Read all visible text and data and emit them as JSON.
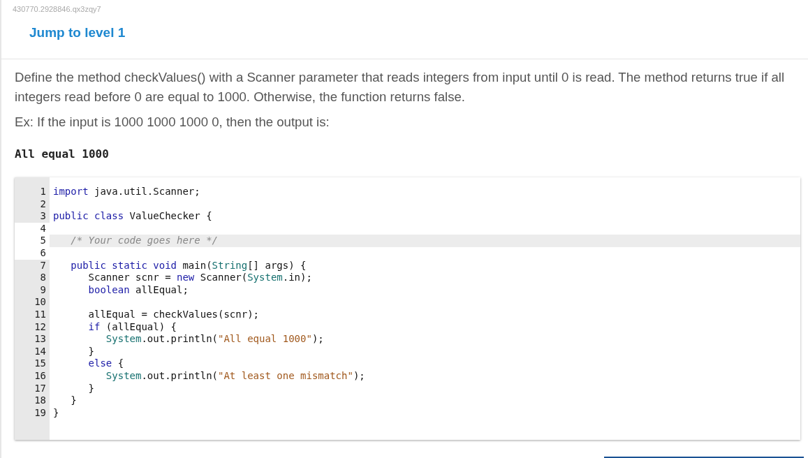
{
  "page_id": "430770.2928846.qx3zqy7",
  "jump_link": "Jump to level 1",
  "instructions": [
    "Define the method checkValues() with a Scanner parameter that reads integers from input until 0 is read. The method returns true if all integers read before 0 are equal to 1000. Otherwise, the function returns false.",
    "Ex: If the input is 1000 1000 1000 0, then the output is:"
  ],
  "example_output": "All equal 1000",
  "editor": {
    "lines": [
      {
        "number": "1",
        "readonly": true,
        "active": false,
        "tokens": [
          {
            "kind": "keyword",
            "text": "import"
          },
          {
            "kind": "plain",
            "text": " java.util.Scanner;"
          }
        ]
      },
      {
        "number": "2",
        "readonly": true,
        "active": false
      },
      {
        "number": "3",
        "readonly": true,
        "active": false,
        "tokens": [
          {
            "kind": "keyword",
            "text": "public class"
          },
          {
            "kind": "plain",
            "text": " ValueChecker {"
          }
        ]
      },
      {
        "number": "4",
        "readonly": false,
        "active": false
      },
      {
        "number": "5",
        "readonly": false,
        "active": true,
        "tokens": [
          {
            "kind": "comment",
            "text": "   /* Your code goes here */"
          }
        ]
      },
      {
        "number": "6",
        "readonly": false,
        "active": false
      },
      {
        "number": "7",
        "readonly": true,
        "active": false,
        "tokens": [
          {
            "kind": "keyword",
            "text": "   public static void"
          },
          {
            "kind": "plain",
            "text": " main("
          },
          {
            "kind": "type",
            "text": "String"
          },
          {
            "kind": "plain",
            "text": "[] args) {"
          }
        ]
      },
      {
        "number": "8",
        "readonly": true,
        "active": false,
        "tokens": [
          {
            "kind": "plain",
            "text": "      Scanner scnr = "
          },
          {
            "kind": "keyword",
            "text": "new"
          },
          {
            "kind": "plain",
            "text": " Scanner("
          },
          {
            "kind": "type",
            "text": "System"
          },
          {
            "kind": "plain",
            "text": ".in);"
          }
        ]
      },
      {
        "number": "9",
        "readonly": true,
        "active": false,
        "tokens": [
          {
            "kind": "keyword",
            "text": "      boolean"
          },
          {
            "kind": "plain",
            "text": " allEqual;"
          }
        ]
      },
      {
        "number": "10",
        "readonly": true,
        "active": false
      },
      {
        "number": "11",
        "readonly": true,
        "active": false,
        "tokens": [
          {
            "kind": "plain",
            "text": "      allEqual = checkValues(scnr);"
          }
        ]
      },
      {
        "number": "12",
        "readonly": true,
        "active": false,
        "tokens": [
          {
            "kind": "keyword",
            "text": "      if"
          },
          {
            "kind": "plain",
            "text": " (allEqual) {"
          }
        ]
      },
      {
        "number": "13",
        "readonly": true,
        "active": false,
        "tokens": [
          {
            "kind": "type",
            "text": "         System"
          },
          {
            "kind": "plain",
            "text": ".out.println("
          },
          {
            "kind": "string",
            "text": "\"All equal 1000\""
          },
          {
            "kind": "plain",
            "text": ");"
          }
        ]
      },
      {
        "number": "14",
        "readonly": true,
        "active": false,
        "tokens": [
          {
            "kind": "plain",
            "text": "      }"
          }
        ]
      },
      {
        "number": "15",
        "readonly": true,
        "active": false,
        "tokens": [
          {
            "kind": "keyword",
            "text": "      else"
          },
          {
            "kind": "plain",
            "text": " {"
          }
        ]
      },
      {
        "number": "16",
        "readonly": true,
        "active": false,
        "tokens": [
          {
            "kind": "type",
            "text": "         System"
          },
          {
            "kind": "plain",
            "text": ".out.println("
          },
          {
            "kind": "string",
            "text": "\"At least one mismatch\""
          },
          {
            "kind": "plain",
            "text": ");"
          }
        ]
      },
      {
        "number": "17",
        "readonly": true,
        "active": false,
        "tokens": [
          {
            "kind": "plain",
            "text": "      }"
          }
        ]
      },
      {
        "number": "18",
        "readonly": true,
        "active": false,
        "tokens": [
          {
            "kind": "plain",
            "text": "   }"
          }
        ]
      },
      {
        "number": "19",
        "readonly": true,
        "active": false,
        "tokens": [
          {
            "kind": "plain",
            "text": "}"
          }
        ]
      }
    ]
  }
}
